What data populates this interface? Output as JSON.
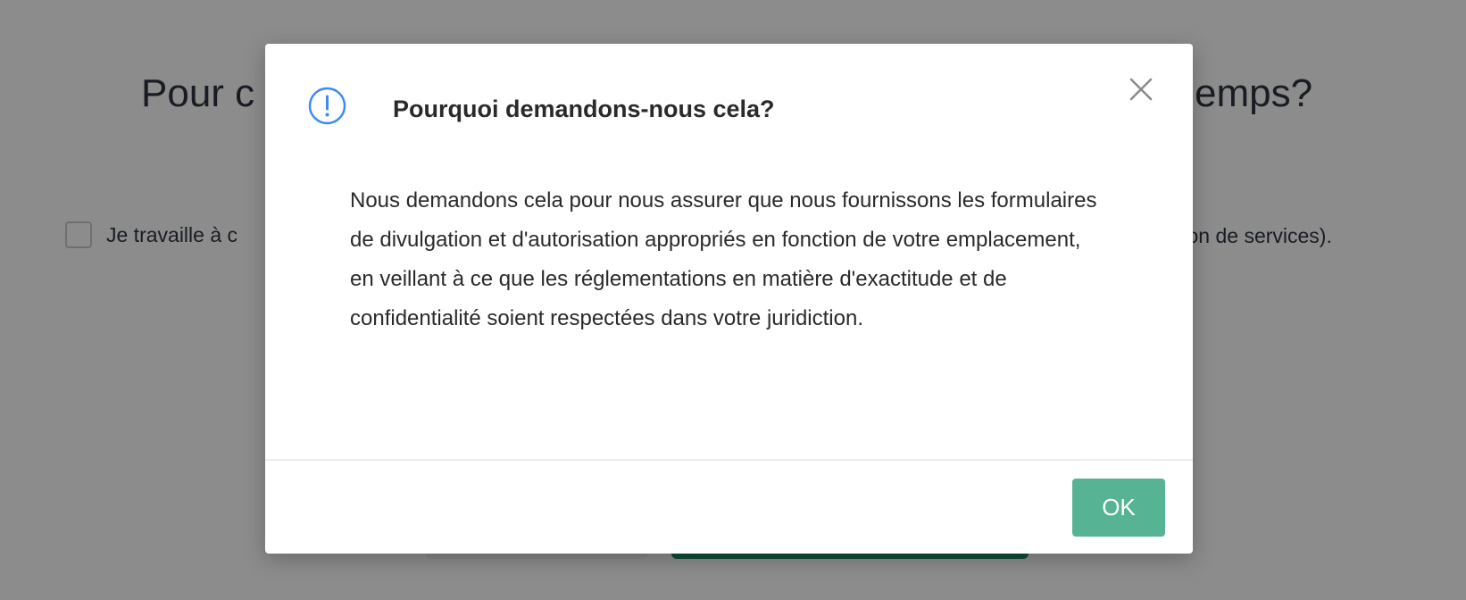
{
  "background": {
    "heading_left": "Pour c",
    "heading_right": "emps?",
    "checkbox_label_left": "Je travaille à c",
    "checkbox_label_right": "tion de services)."
  },
  "modal": {
    "icon": "info-circle-icon",
    "title": "Pourquoi demandons-nous cela?",
    "close_icon": "close-icon",
    "body": "Nous demandons cela pour nous assurer que nous fournissons les formulaires de divulgation et d'autorisation appropriés en fonction de votre emplacement, en veillant à ce que les réglementations en matière d'exactitude et de confidentialité soient respectées dans votre juridiction.",
    "ok_label": "OK"
  },
  "colors": {
    "accent": "#56b394",
    "info_icon": "#3b8bf5",
    "overlay": "rgba(0,0,0,0.45)"
  }
}
